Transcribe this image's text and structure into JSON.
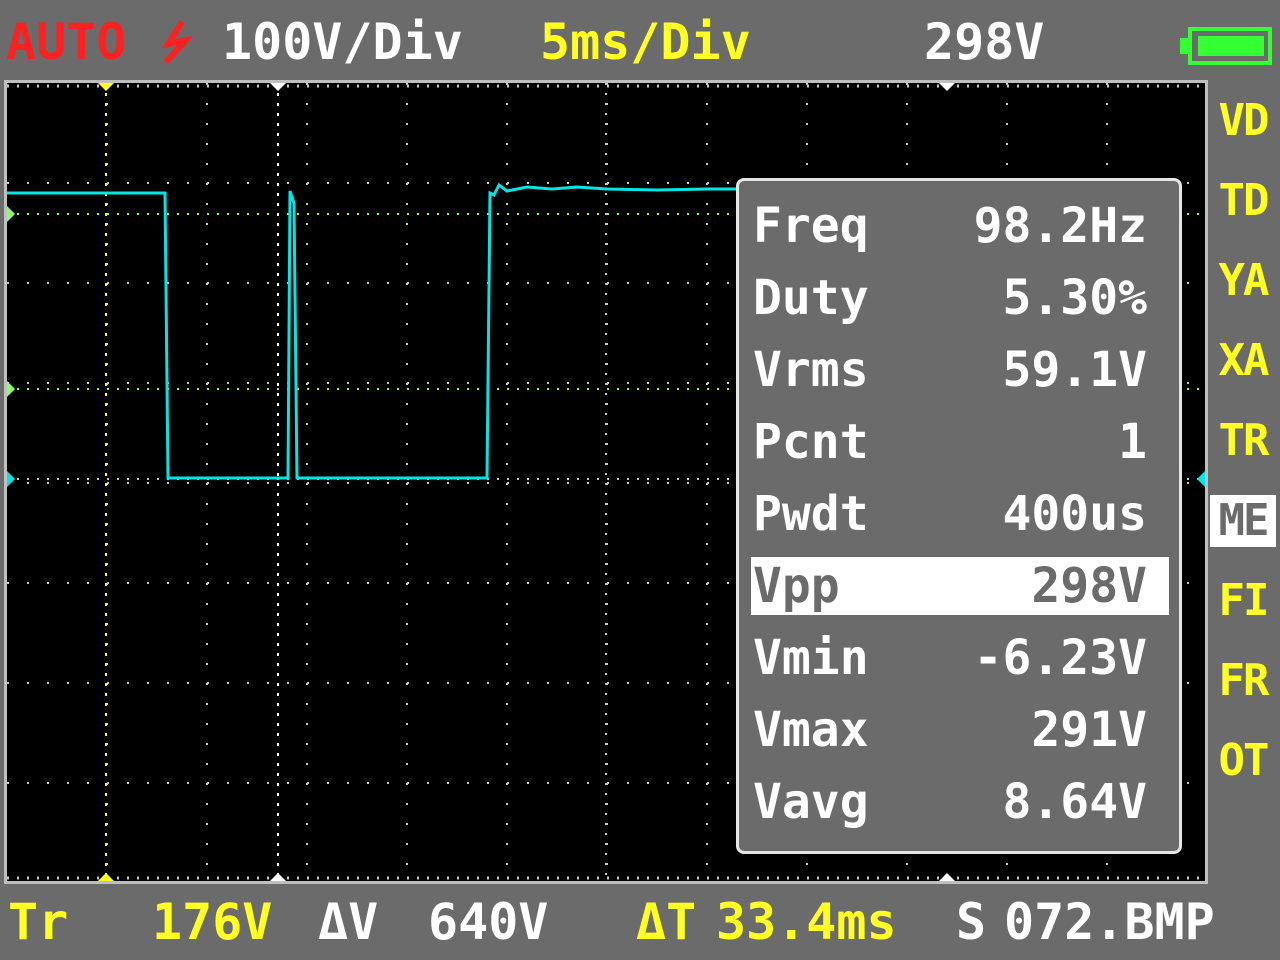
{
  "header": {
    "mode": "AUTO",
    "trigger_edge_icon": "falling-edge-trigger-icon",
    "volts_div": "100V/Div",
    "time_div": "5ms/Div",
    "reading": "298V",
    "battery_icon": "battery-icon",
    "battery_level": 1.0
  },
  "side_menu": {
    "items": [
      "VD",
      "TD",
      "YA",
      "XA",
      "TR",
      "ME",
      "FI",
      "FR",
      "OT"
    ],
    "active": "ME"
  },
  "measurements": {
    "rows": [
      {
        "label": "Freq",
        "value": "98.2Hz"
      },
      {
        "label": "Duty",
        "value": "5.30%"
      },
      {
        "label": "Vrms",
        "value": "59.1V"
      },
      {
        "label": "Pcnt",
        "value": "1"
      },
      {
        "label": "Pwdt",
        "value": "400us"
      },
      {
        "label": "Vpp",
        "value": "298V"
      },
      {
        "label": "Vmin",
        "value": "-6.23V"
      },
      {
        "label": "Vmax",
        "value": "291V"
      },
      {
        "label": "Vavg",
        "value": "8.64V"
      }
    ],
    "selected_index": 5
  },
  "footer": {
    "tr_label": "Tr",
    "tr_value": "176V",
    "dv_label": "ΔV",
    "dv_value": "640V",
    "dt_label": "ΔT",
    "dt_value": "33.4ms",
    "save_label": "S",
    "save_file": "072.BMP"
  },
  "colors": {
    "background": "#6b6b6b",
    "screen": "#000000",
    "trace": "#00e5e5",
    "yellow": "#ffff22",
    "red": "#ff2020",
    "grid": "#c8c8c8",
    "cursor_green": "#88ff66",
    "battery": "#33ff33"
  }
}
